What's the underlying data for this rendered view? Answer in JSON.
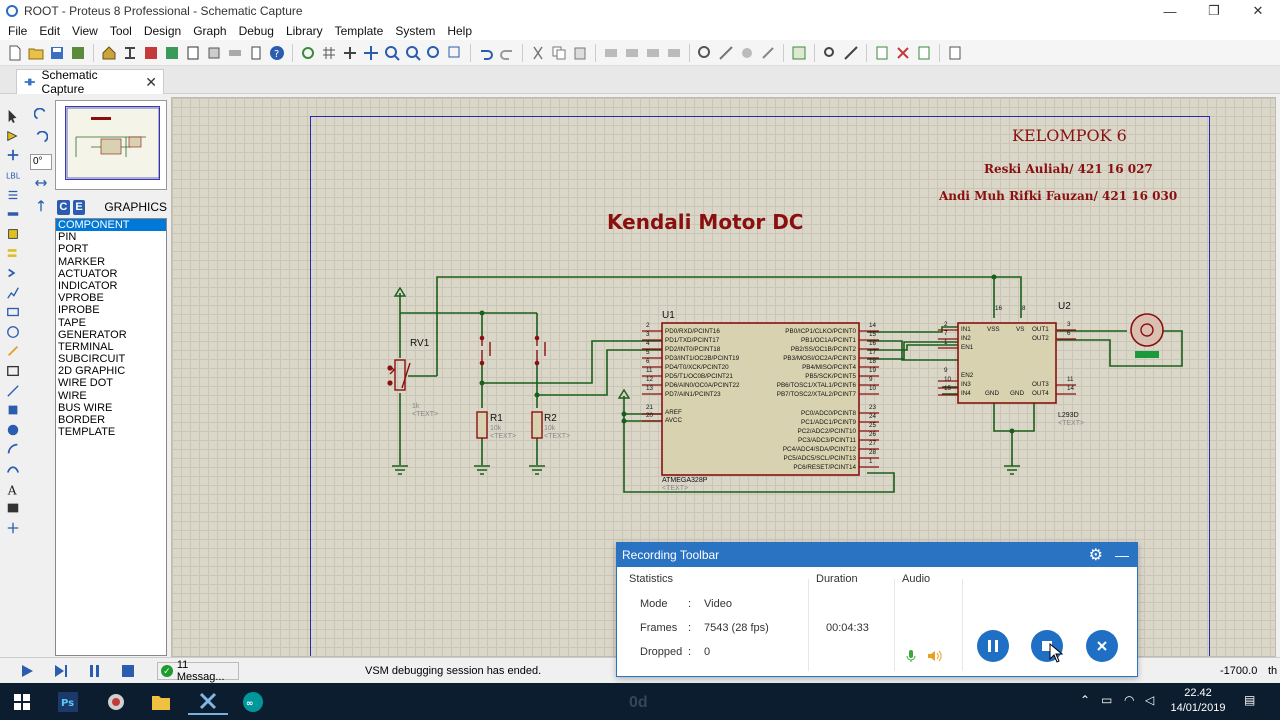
{
  "window": {
    "title": "ROOT - Proteus 8 Professional - Schematic Capture",
    "minimize": "—",
    "restore": "❐",
    "close": "✕"
  },
  "menu": [
    "File",
    "Edit",
    "View",
    "Tool",
    "Design",
    "Graph",
    "Debug",
    "Library",
    "Template",
    "System",
    "Help"
  ],
  "tab": {
    "label": "Schematic Capture",
    "close": "✕"
  },
  "side_panel": {
    "rotation_value": "0°",
    "mode_c": "C",
    "mode_e": "E",
    "header": "GRAPHICS",
    "items": [
      "COMPONENT",
      "PIN",
      "PORT",
      "MARKER",
      "ACTUATOR",
      "INDICATOR",
      "VPROBE",
      "IPROBE",
      "TAPE",
      "GENERATOR",
      "TERMINAL",
      "SUBCIRCUIT",
      "2D GRAPHIC",
      "WIRE DOT",
      "WIRE",
      "BUS WIRE",
      "BORDER",
      "TEMPLATE"
    ],
    "selected_index": 0
  },
  "schematic": {
    "group": "KELOMPOK 6",
    "member1": "Reski Auliah/ 421 16 027",
    "member2": "Andi Muh Rifki Fauzan/ 421 16 030",
    "title": "Kendali Motor DC",
    "rv1": {
      "ref": "RV1",
      "value": "1k",
      "text": "<TEXT>"
    },
    "r1": {
      "ref": "R1",
      "value": "10k",
      "text": "<TEXT>"
    },
    "r2": {
      "ref": "R2",
      "value": "10k",
      "text": "<TEXT>"
    },
    "u1": {
      "ref": "U1",
      "part": "ATMEGA328P",
      "text": "<TEXT>",
      "left_pins": [
        {
          "num": "2",
          "name": "PD0/RXD/PCINT16"
        },
        {
          "num": "3",
          "name": "PD1/TXD/PCINT17"
        },
        {
          "num": "4",
          "name": "PD2/INT0/PCINT18"
        },
        {
          "num": "5",
          "name": "PD3/INT1/OC2B/PCINT19"
        },
        {
          "num": "6",
          "name": "PD4/T0/XCK/PCINT20"
        },
        {
          "num": "11",
          "name": "PD5/T1/OC0B/PCINT21"
        },
        {
          "num": "12",
          "name": "PD6/AIN0/OC0A/PCINT22"
        },
        {
          "num": "13",
          "name": "PD7/AIN1/PCINT23"
        }
      ],
      "left_power": [
        {
          "num": "21",
          "name": "AREF"
        },
        {
          "num": "20",
          "name": "AVCC"
        }
      ],
      "right_pins_b": [
        {
          "num": "14",
          "name": "PB0/ICP1/CLKO/PCINT0"
        },
        {
          "num": "15",
          "name": "PB1/OC1A/PCINT1"
        },
        {
          "num": "16",
          "name": "PB2/SS/OC1B/PCINT2"
        },
        {
          "num": "17",
          "name": "PB3/MOSI/OC2A/PCINT3"
        },
        {
          "num": "18",
          "name": "PB4/MISO/PCINT4"
        },
        {
          "num": "19",
          "name": "PB5/SCK/PCINT5"
        },
        {
          "num": "9",
          "name": "PB6/TOSC1/XTAL1/PCINT6"
        },
        {
          "num": "10",
          "name": "PB7/TOSC2/XTAL2/PCINT7"
        }
      ],
      "right_pins_c": [
        {
          "num": "23",
          "name": "PC0/ADC0/PCINT8"
        },
        {
          "num": "24",
          "name": "PC1/ADC1/PCINT9"
        },
        {
          "num": "25",
          "name": "PC2/ADC2/PCINT10"
        },
        {
          "num": "26",
          "name": "PC3/ADC3/PCINT11"
        },
        {
          "num": "27",
          "name": "PC4/ADC4/SDA/PCINT12"
        },
        {
          "num": "28",
          "name": "PC5/ADC5/SCL/PCINT13"
        },
        {
          "num": "1",
          "name": "PC6/RESET/PCINT14"
        }
      ]
    },
    "u2": {
      "ref": "U2",
      "part": "L293D",
      "text": "<TEXT>",
      "pin_top_16": "16",
      "pin_top_8": "8",
      "left_pins": [
        {
          "num": "2",
          "name": "IN1"
        },
        {
          "num": "7",
          "name": "IN2"
        },
        {
          "num": "1",
          "name": "EN1"
        },
        {
          "num": "9",
          "name": "EN2"
        },
        {
          "num": "10",
          "name": "IN3"
        },
        {
          "num": "15",
          "name": "IN4"
        }
      ],
      "right_pins": [
        {
          "num": "3",
          "name": "OUT1"
        },
        {
          "num": "6",
          "name": "OUT2"
        },
        {
          "num": "11",
          "name": "OUT3"
        },
        {
          "num": "14",
          "name": "OUT4"
        }
      ],
      "vss": "VSS",
      "vs": "VS",
      "gnd": "GND"
    }
  },
  "status": {
    "messages": "11 Messag...",
    "text": "VSM debugging session has ended.",
    "coord": "-1700.0",
    "coord2": "th"
  },
  "recording": {
    "title": "Recording Toolbar",
    "stats_label": "Statistics",
    "duration_label": "Duration",
    "audio_label": "Audio",
    "mode_key": "Mode",
    "mode_val": "Video",
    "frames_key": "Frames",
    "frames_val": "7543 (28 fps)",
    "dropped_key": "Dropped",
    "dropped_val": "0",
    "colon": ":",
    "duration_val": "00:04:33"
  },
  "taskbar": {
    "time": "22.42",
    "date": "14/01/2019",
    "faded": "0d"
  },
  "colors": {
    "accent": "#2a73c2",
    "wire": "#1a5e1a",
    "component": "#8a1010",
    "canvas": "#dad7c9",
    "chip": "#d9d2b0"
  }
}
